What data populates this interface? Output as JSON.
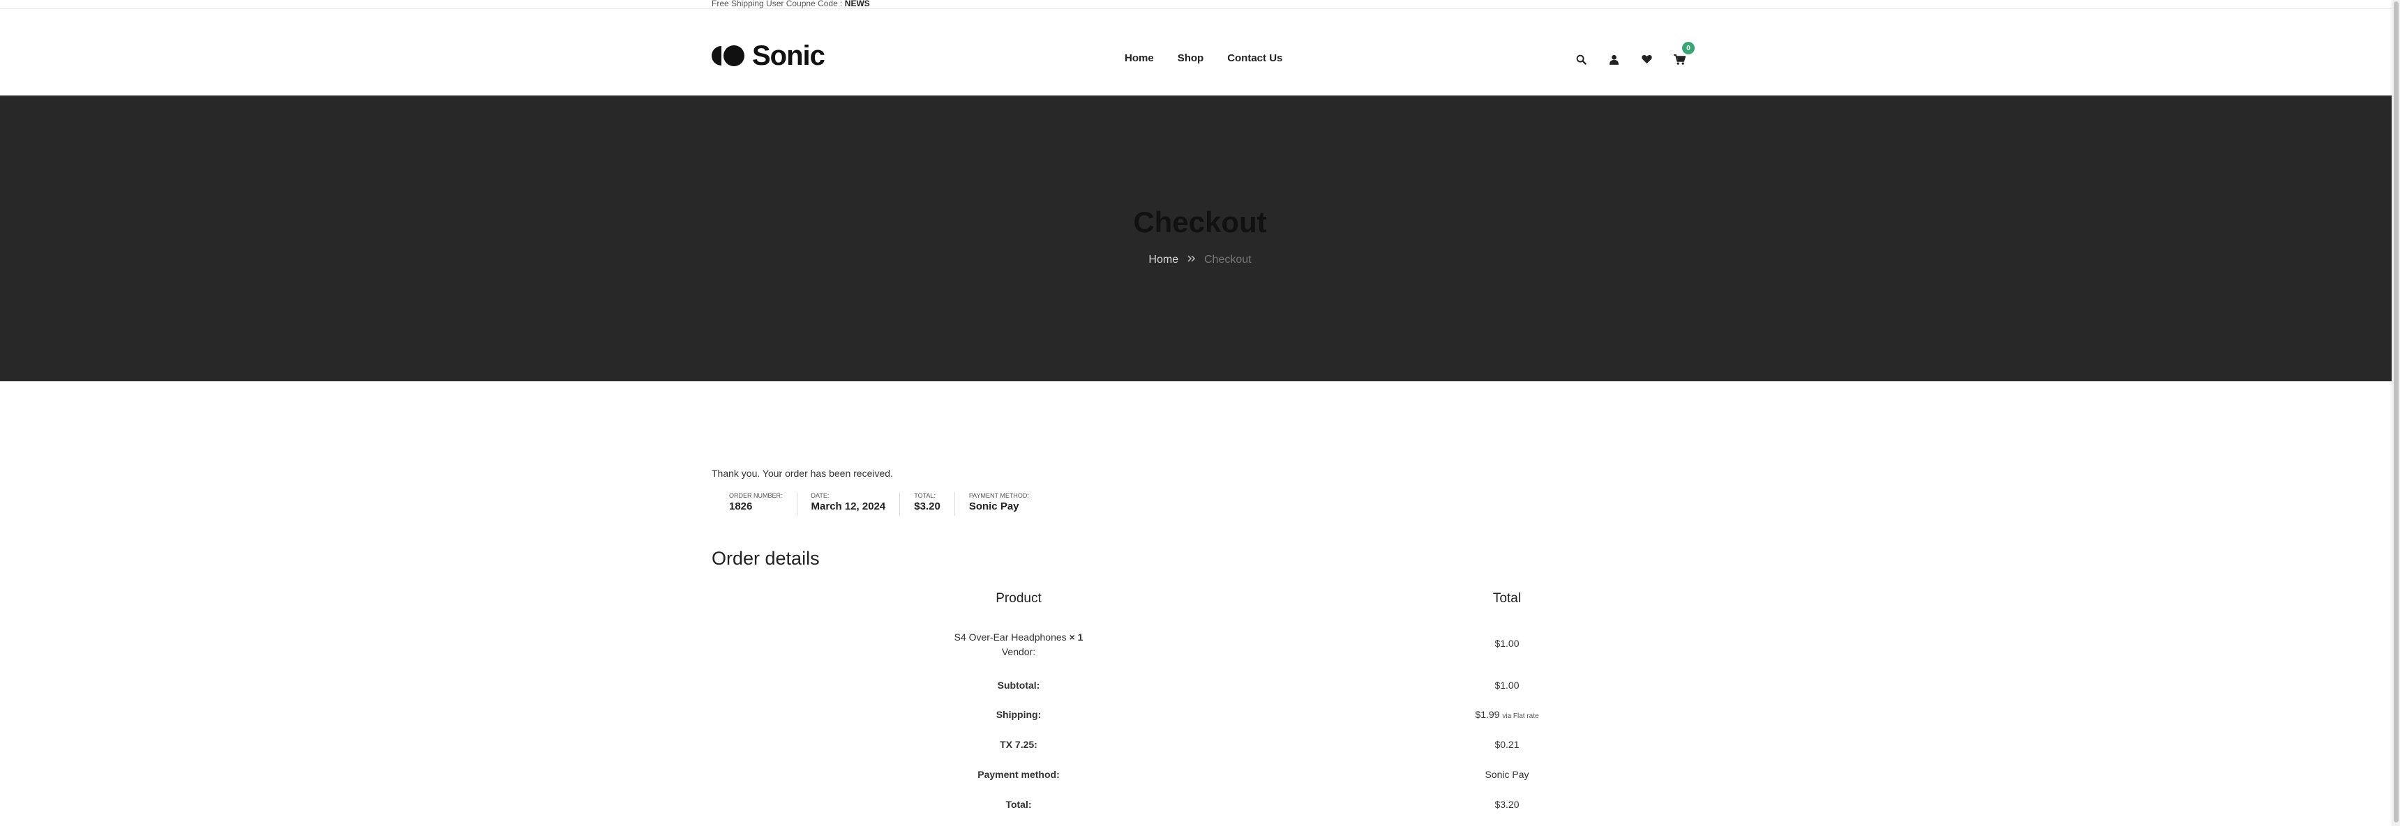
{
  "topbar": {
    "text": "Free Shipping User Coupne Code :",
    "code": "NEWS"
  },
  "header": {
    "logo_text": "Sonic",
    "nav": [
      {
        "label": "Home"
      },
      {
        "label": "Shop"
      },
      {
        "label": "Contact Us"
      }
    ],
    "cart_count": "0"
  },
  "hero": {
    "title": "Checkout",
    "breadcrumb_home": "Home",
    "breadcrumb_current": "Checkout"
  },
  "order": {
    "thanks": "Thank you. Your order has been received.",
    "overview": [
      {
        "label": "Order number:",
        "value": "1826"
      },
      {
        "label": "Date:",
        "value": "March 12, 2024"
      },
      {
        "label": "Total:",
        "value": "$3.20"
      },
      {
        "label": "Payment method:",
        "value": "Sonic Pay"
      }
    ],
    "details_title": "Order details",
    "table": {
      "col_product": "Product",
      "col_total": "Total",
      "item_name": "S4 Over-Ear Headphones",
      "item_qty": "× 1",
      "item_vendor": "Vendor:",
      "item_total": "$1.00",
      "subtotal_label": "Subtotal:",
      "subtotal_value": "$1.00",
      "shipping_label": "Shipping:",
      "shipping_value": "$1.99",
      "shipping_note": "via Flat rate",
      "tax_label": "TX 7.25:",
      "tax_value": "$0.21",
      "payment_label": "Payment method:",
      "payment_value": "Sonic Pay",
      "total_label": "Total:",
      "total_value": "$3.20"
    }
  },
  "colors": {
    "hero_bg": "#282828",
    "badge": "#3aa675"
  }
}
